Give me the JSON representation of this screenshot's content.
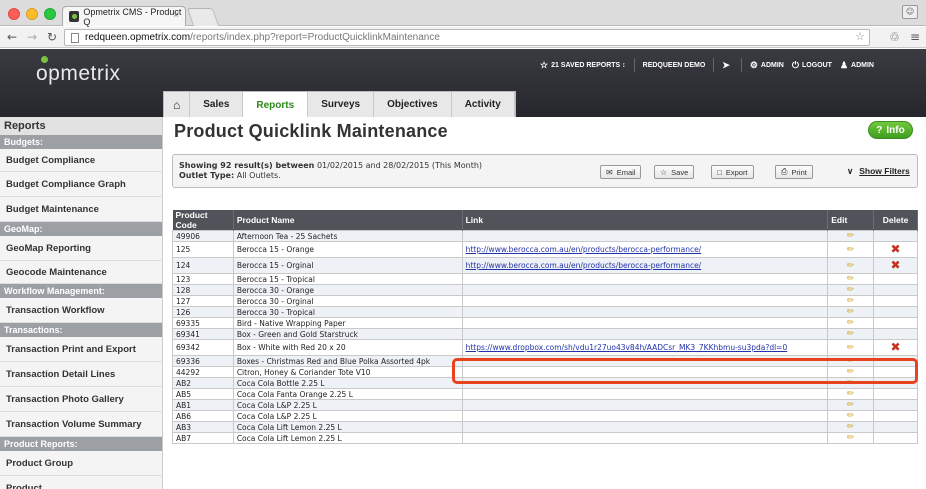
{
  "browser": {
    "tab_title": "Opmetrix CMS - Product Q",
    "tab_close": "×",
    "url_host": "redqueen.opmetrix.com",
    "url_path": "/reports/index.php?report=ProductQuicklinkMaintenance"
  },
  "header": {
    "logo": "opmetrix",
    "saved_reports": "21 SAVED REPORTS",
    "saved_reports_caret": "↕",
    "demo": "REDQUEEN DEMO",
    "admin_settings": "ADMIN",
    "logout": "LOGOUT",
    "admin_user": "ADMIN"
  },
  "nav": {
    "tabs": [
      "Sales",
      "Reports",
      "Surveys",
      "Objectives",
      "Activity"
    ],
    "active": "Reports"
  },
  "sidebar": {
    "title": "Reports",
    "sections": [
      {
        "head": "Budgets:",
        "items": [
          "Budget Compliance",
          "Budget Compliance Graph",
          "Budget Maintenance"
        ]
      },
      {
        "head": "GeoMap:",
        "items": [
          "GeoMap Reporting",
          "Geocode Maintenance"
        ]
      },
      {
        "head": "Workflow Management:",
        "items": [
          "Transaction Workflow"
        ]
      },
      {
        "head": "Transactions:",
        "items": [
          "Transaction Print and Export",
          "Transaction Detail Lines",
          "Transaction Photo Gallery",
          "Transaction Volume Summary"
        ]
      },
      {
        "head": "Product Reports:",
        "items": [
          "Product Group",
          "Product"
        ]
      }
    ]
  },
  "main": {
    "title": "Product Quicklink Maintenance",
    "info_label": "Info",
    "summary_prefix": "Showing 92 result(s) between",
    "summary_dates": "01/02/2015 and 28/02/2015 (This Month)",
    "outlet_label": "Outlet Type:",
    "outlet_value": "All Outlets.",
    "buttons": {
      "email": "Email",
      "save": "Save",
      "export": "Export",
      "print": "Print"
    },
    "show_filters": "Show Filters"
  },
  "table": {
    "columns": [
      "Product Code",
      "Product Name",
      "Link",
      "Edit",
      "Delete"
    ],
    "rows": [
      {
        "code": "49906",
        "name": "Afternoon Tea - 25 Sachets",
        "link": "",
        "del": false
      },
      {
        "code": "125",
        "name": "Berocca 15 - Orange",
        "link": "http://www.berocca.com.au/en/products/berocca-performance/",
        "del": true
      },
      {
        "code": "124",
        "name": "Berocca 15 - Orginal",
        "link": "http://www.berocca.com.au/en/products/berocca-performance/",
        "del": true
      },
      {
        "code": "123",
        "name": "Berocca 15 - Tropical",
        "link": "",
        "del": false
      },
      {
        "code": "128",
        "name": "Berocca 30 - Orange",
        "link": "",
        "del": false
      },
      {
        "code": "127",
        "name": "Berocca 30 - Orginal",
        "link": "",
        "del": false
      },
      {
        "code": "126",
        "name": "Berocca 30 - Tropical",
        "link": "",
        "del": false
      },
      {
        "code": "69335",
        "name": "Bird - Native Wrapping Paper",
        "link": "",
        "del": false
      },
      {
        "code": "69341",
        "name": "Box - Green and Gold Starstruck",
        "link": "",
        "del": false
      },
      {
        "code": "69342",
        "name": "Box - White with Red 20 x 20",
        "link": "https://www.dropbox.com/sh/vdu1r27uo43v84h/AADCsr_MK3_7KKhbmu-su3pda?dl=0",
        "del": true
      },
      {
        "code": "69336",
        "name": "Boxes - Christmas Red and Blue Polka Assorted 4pk",
        "link": "",
        "del": false
      },
      {
        "code": "44292",
        "name": "Citron, Honey & Coriander Tote V10",
        "link": "",
        "del": false
      },
      {
        "code": "AB2",
        "name": "Coca Cola Bottle 2.25 L",
        "link": "",
        "del": false
      },
      {
        "code": "AB5",
        "name": "Coca Cola Fanta Orange 2.25 L",
        "link": "",
        "del": false
      },
      {
        "code": "AB1",
        "name": "Coca Cola L&P 2.25 L",
        "link": "",
        "del": false
      },
      {
        "code": "AB6",
        "name": "Coca Cola L&P 2.25 L",
        "link": "",
        "del": false
      },
      {
        "code": "AB3",
        "name": "Coca Cola Lift Lemon 2.25 L",
        "link": "",
        "del": false
      },
      {
        "code": "AB7",
        "name": "Coca Cola Lift Lemon 2.25 L",
        "link": "",
        "del": false
      }
    ]
  },
  "icons": {
    "edit": "pencil-icon",
    "delete": "x-icon"
  },
  "colors": {
    "accent": "#2a8a1a",
    "delete": "#c8321e",
    "highlight": "#e8421e",
    "link": "#2233aa"
  }
}
